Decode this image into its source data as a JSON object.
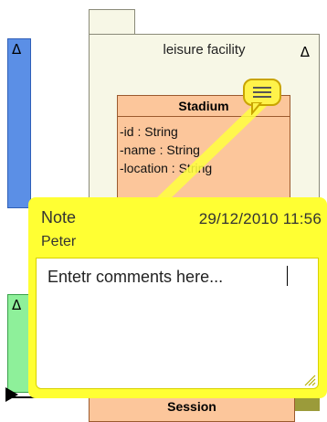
{
  "left_packages": {
    "top_symbol": "Δ",
    "bottom_symbol": "Δ"
  },
  "package": {
    "name": "leisure facility",
    "symbol": "Δ"
  },
  "stadium_class": {
    "name": "Stadium",
    "attributes": [
      "-id : String",
      "-name : String",
      "-location : String"
    ]
  },
  "session_class": {
    "name": "Session"
  },
  "note_icon": "note-bubble-icon",
  "note": {
    "title": "Note",
    "datetime": "29/12/2010 11:56",
    "author": "Peter",
    "comment_text": "Entetr comments here..."
  },
  "colors": {
    "note_yellow": "#ffff33",
    "class_fill": "#fcc69b",
    "package_fill": "#f7f7e6",
    "blue_package": "#5b8fe6",
    "green_package": "#8ef09a"
  }
}
